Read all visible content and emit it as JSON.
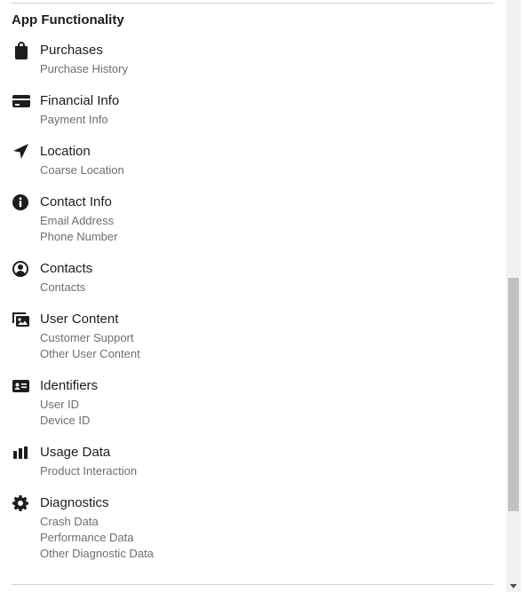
{
  "section": {
    "title": "App Functionality"
  },
  "categories": [
    {
      "name": "Purchases",
      "icon": "shopping-bag-icon",
      "items": [
        "Purchase History"
      ]
    },
    {
      "name": "Financial Info",
      "icon": "credit-card-icon",
      "items": [
        "Payment Info"
      ]
    },
    {
      "name": "Location",
      "icon": "location-arrow-icon",
      "items": [
        "Coarse Location"
      ]
    },
    {
      "name": "Contact Info",
      "icon": "info-circle-icon",
      "items": [
        "Email Address",
        "Phone Number"
      ]
    },
    {
      "name": "Contacts",
      "icon": "person-circle-icon",
      "items": [
        "Contacts"
      ]
    },
    {
      "name": "User Content",
      "icon": "photo-stack-icon",
      "items": [
        "Customer Support",
        "Other User Content"
      ]
    },
    {
      "name": "Identifiers",
      "icon": "id-card-icon",
      "items": [
        "User ID",
        "Device ID"
      ]
    },
    {
      "name": "Usage Data",
      "icon": "bar-chart-icon",
      "items": [
        "Product Interaction"
      ]
    },
    {
      "name": "Diagnostics",
      "icon": "gear-icon",
      "items": [
        "Crash Data",
        "Performance Data",
        "Other Diagnostic Data"
      ]
    }
  ],
  "colors": {
    "text_primary": "#1d1d1f",
    "text_secondary": "#6e6e73",
    "divider": "#d2d2d7",
    "scrollbar_track": "#f1f1f1",
    "scrollbar_thumb": "#c1c1c1"
  }
}
